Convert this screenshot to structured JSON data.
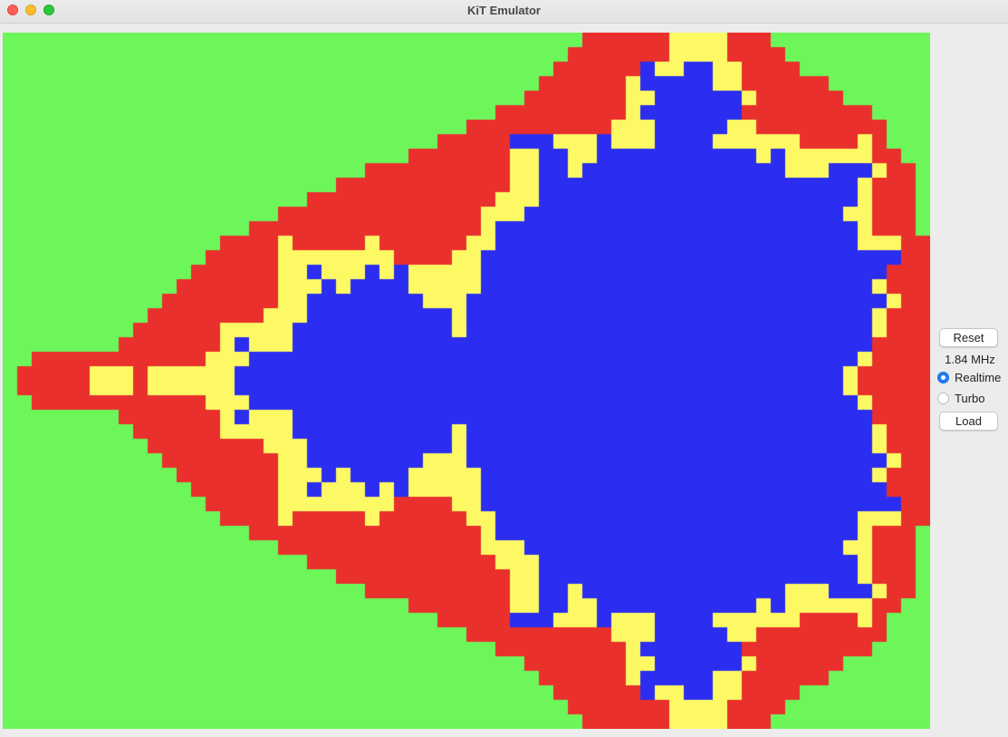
{
  "window": {
    "title": "KiT Emulator"
  },
  "controls": {
    "reset_label": "Reset",
    "frequency": "1.84 MHz",
    "speed_options": [
      {
        "label": "Realtime",
        "selected": true
      },
      {
        "label": "Turbo",
        "selected": false
      }
    ],
    "load_label": "Load"
  },
  "display": {
    "content": "Mandelbrot set rendered in 4 colours",
    "palette": {
      "inside": "#2b2ef0",
      "band_1": "#fcf965",
      "band_2": "#e9302c",
      "band_3": "#6cf65a"
    }
  },
  "icons": {
    "close": "close-icon",
    "minimize": "minimize-icon",
    "maximize": "maximize-icon"
  }
}
